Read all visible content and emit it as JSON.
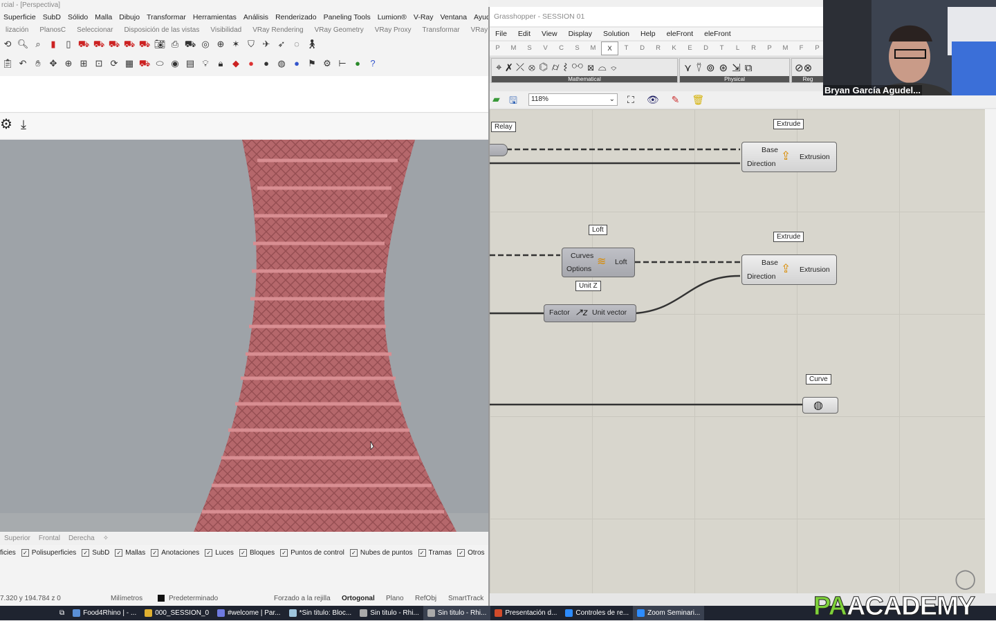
{
  "rhino": {
    "title": "rcial - [Perspectiva]",
    "menu": [
      "Superficie",
      "SubD",
      "Sólido",
      "Malla",
      "Dibujo",
      "Transformar",
      "Herramientas",
      "Análisis",
      "Renderizado",
      "Paneling Tools",
      "Lumion®",
      "V-Ray",
      "Ventana",
      "Ayuda"
    ],
    "tabs": [
      "lización",
      "PlanosC",
      "Seleccionar",
      "Disposición de las vistas",
      "Visibilidad",
      "VRay Rendering",
      "VRay Geometry",
      "VRay Proxy",
      "Transformar",
      "VRay Ligh"
    ],
    "viewport_tabs": [
      "Superior",
      "Frontal",
      "Derecha"
    ],
    "osnaps": [
      "ficies",
      "Polisuperficies",
      "SubD",
      "Mallas",
      "Anotaciones",
      "Luces",
      "Bloques",
      "Puntos de control",
      "Nubes de puntos",
      "Tramas",
      "Otros"
    ],
    "status": {
      "coords": "7.320  y 194.784  z 0",
      "units": "Milímetros",
      "layer": "Predeterminado",
      "grid_snap": "Forzado a la rejilla",
      "ortho": "Ortogonal",
      "planar": "Plano",
      "osnap": "RefObj",
      "smarttrack": "SmartTrack"
    }
  },
  "grasshopper": {
    "title": "Grasshopper - SESSION 01",
    "menu": [
      "File",
      "Edit",
      "View",
      "Display",
      "Solution",
      "Help",
      "eleFront",
      "eleFront"
    ],
    "categories": [
      "P",
      "M",
      "S",
      "V",
      "C",
      "S",
      "M",
      "X",
      "T",
      "D",
      "R",
      "K",
      "E",
      "D",
      "T",
      "L",
      "R",
      "P",
      "M",
      "F",
      "P"
    ],
    "active_category": "X",
    "panels": [
      "Mathematical",
      "Physical",
      "Reg"
    ],
    "zoom": "118%",
    "tags": {
      "relay": "Relay",
      "extrude1": "Extrude",
      "loft": "Loft",
      "extrude2": "Extrude",
      "unitz": "Unit Z",
      "curve": "Curve"
    },
    "nodes": {
      "extrude1": {
        "in1": "Base",
        "in2": "Direction",
        "out": "Extrusion"
      },
      "loft": {
        "in1": "Curves",
        "in2": "Options",
        "out": "Loft"
      },
      "extrude2": {
        "in1": "Base",
        "in2": "Direction",
        "out": "Extrusion"
      },
      "unitz": {
        "in": "Factor",
        "out": "Unit vector"
      }
    }
  },
  "webcam": {
    "name": "Bryan García Agudel..."
  },
  "taskbar": [
    "Food4Rhino | - ...",
    "000_SESSION_0",
    "#welcome | Par...",
    "*Sin titulo: Bloc...",
    "Sin titulo - Rhi...",
    "Sin titulo - Rhi...",
    "Presentación d...",
    "Controles de re...",
    "Zoom Seminari..."
  ],
  "brand": {
    "pa": "PA",
    "rest": "ACADEMY"
  },
  "colors": {
    "tower": "#b5676b",
    "canvas": "#d8d6cd",
    "brand_green": "#7ed13a"
  }
}
